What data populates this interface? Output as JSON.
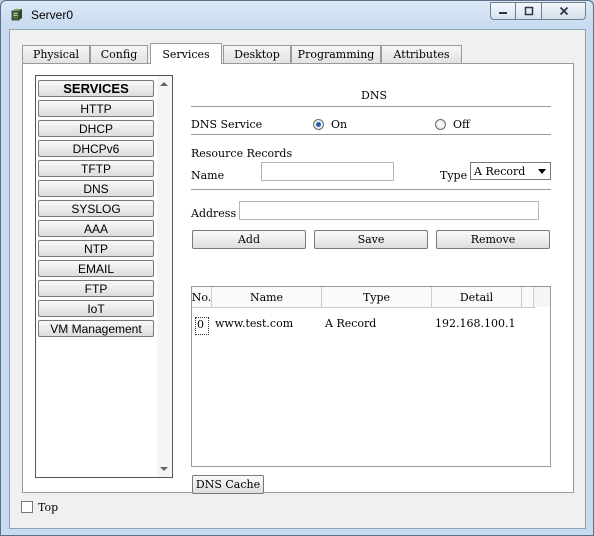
{
  "window": {
    "title": "Server0"
  },
  "tabs": [
    {
      "label": "Physical"
    },
    {
      "label": "Config"
    },
    {
      "label": "Services"
    },
    {
      "label": "Desktop"
    },
    {
      "label": "Programming"
    },
    {
      "label": "Attributes"
    }
  ],
  "active_tab": "Services",
  "services": {
    "header": "SERVICES",
    "items": [
      "HTTP",
      "DHCP",
      "DHCPv6",
      "TFTP",
      "DNS",
      "SYSLOG",
      "AAA",
      "NTP",
      "EMAIL",
      "FTP",
      "IoT",
      "VM Management"
    ]
  },
  "dns": {
    "section_title": "DNS",
    "service_label": "DNS Service",
    "on_label": "On",
    "off_label": "Off",
    "service_state": "On",
    "resource_records_label": "Resource Records",
    "name_label": "Name",
    "name_value": "",
    "type_label": "Type",
    "type_value": "A Record",
    "address_label": "Address",
    "address_value": "",
    "add_button": "Add",
    "save_button": "Save",
    "remove_button": "Remove",
    "table": {
      "columns": [
        "No.",
        "Name",
        "Type",
        "Detail"
      ],
      "rows": [
        {
          "no": "0",
          "name": "www.test.com",
          "type": "A Record",
          "detail": "192.168.100.1"
        }
      ]
    },
    "cache_button": "DNS Cache"
  },
  "footer": {
    "top_label": "Top",
    "top_checked": false
  }
}
